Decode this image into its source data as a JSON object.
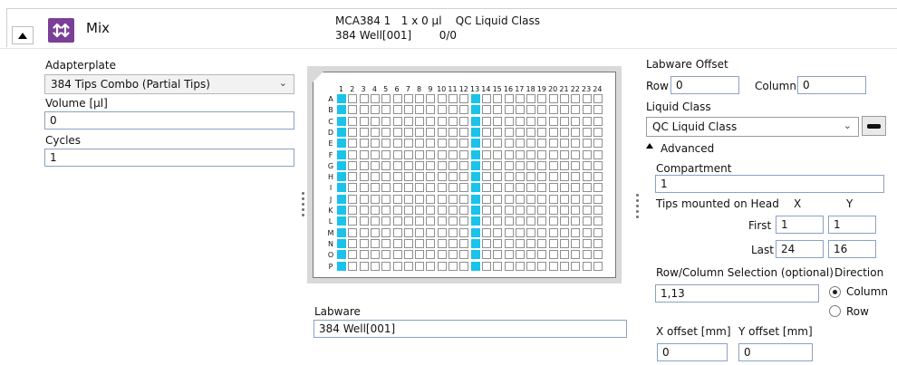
{
  "header": {
    "title": "Mix",
    "info_line1": "MCA384 1   1 x 0 µl    QC Liquid Class",
    "info_line2": "384 Well[001]        0/0"
  },
  "left": {
    "adapterplate_label": "Adapterplate",
    "adapterplate_value": "384 Tips Combo (Partial Tips)",
    "volume_label": "Volume [µl]",
    "volume_value": "0",
    "cycles_label": "Cycles",
    "cycles_value": "1"
  },
  "plate": {
    "columns": [
      "1",
      "2",
      "3",
      "4",
      "5",
      "6",
      "7",
      "8",
      "9",
      "10",
      "11",
      "12",
      "13",
      "14",
      "15",
      "16",
      "17",
      "18",
      "19",
      "20",
      "21",
      "22",
      "23",
      "24"
    ],
    "rows": [
      "A",
      "B",
      "C",
      "D",
      "E",
      "F",
      "G",
      "H",
      "I",
      "J",
      "K",
      "L",
      "M",
      "N",
      "O",
      "P"
    ],
    "selected_columns": [
      1,
      13
    ],
    "selected_color": "#19c3ea"
  },
  "labware": {
    "label": "Labware",
    "value": "384 Well[001]"
  },
  "right": {
    "labware_offset_label": "Labware Offset",
    "row_label": "Row",
    "row_value": "0",
    "column_label": "Column",
    "column_value": "0",
    "liquid_class_label": "Liquid Class",
    "liquid_class_value": "QC Liquid Class",
    "advanced_label": "Advanced",
    "compartment_label": "Compartment",
    "compartment_value": "1",
    "tips_label": "Tips mounted on Head",
    "x_label": "X",
    "y_label": "Y",
    "first_label": "First",
    "first_x": "1",
    "first_y": "1",
    "last_label": "Last",
    "last_x": "24",
    "last_y": "16",
    "rowcol_label": "Row/Column Selection (optional)",
    "rowcol_value": "1,13",
    "direction_label": "Direction",
    "direction_column": "Column",
    "direction_row": "Row",
    "direction_selected": "Column",
    "xoffset_label": "X offset [mm]",
    "xoffset_value": "0",
    "yoffset_label": "Y offset [mm]",
    "yoffset_value": "0"
  }
}
